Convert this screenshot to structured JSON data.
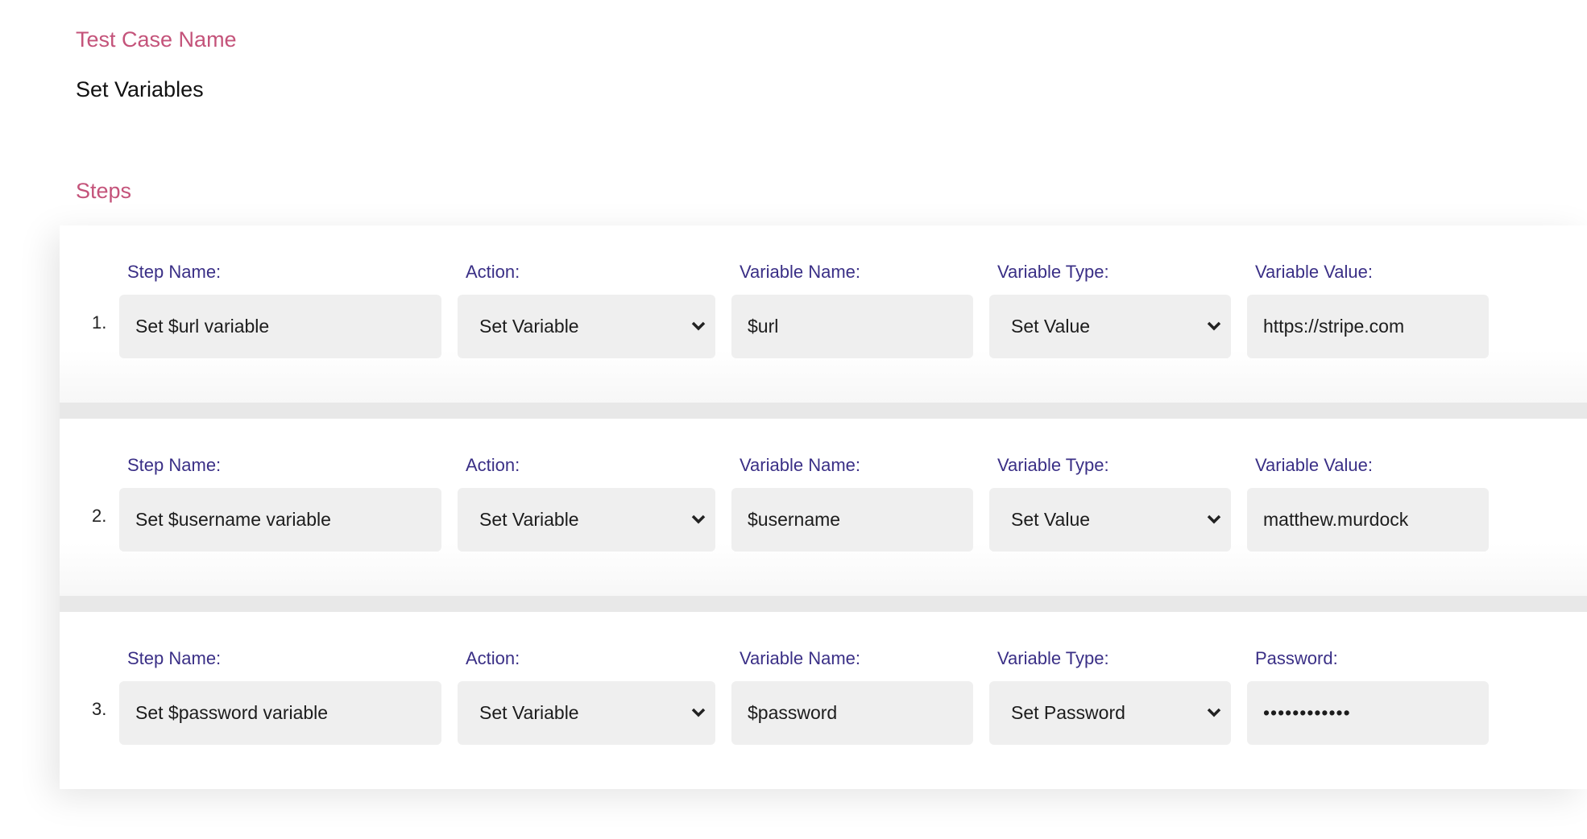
{
  "test_case": {
    "label": "Test Case Name",
    "value": "Set Variables"
  },
  "steps_label": "Steps",
  "steps": [
    {
      "number": "1.",
      "step_name_label": "Step Name:",
      "step_name": "Set $url variable",
      "action_label": "Action:",
      "action": "Set Variable",
      "variable_name_label": "Variable Name:",
      "variable_name": "$url",
      "variable_type_label": "Variable Type:",
      "variable_type": "Set Value",
      "value_label": "Variable Value:",
      "value": "https://stripe.com"
    },
    {
      "number": "2.",
      "step_name_label": "Step Name:",
      "step_name": "Set $username variable",
      "action_label": "Action:",
      "action": "Set Variable",
      "variable_name_label": "Variable Name:",
      "variable_name": "$username",
      "variable_type_label": "Variable Type:",
      "variable_type": "Set Value",
      "value_label": "Variable Value:",
      "value": "matthew.murdock"
    },
    {
      "number": "3.",
      "step_name_label": "Step Name:",
      "step_name": "Set $password variable",
      "action_label": "Action:",
      "action": "Set Variable",
      "variable_name_label": "Variable Name:",
      "variable_name": "$password",
      "variable_type_label": "Variable Type:",
      "variable_type": "Set Password",
      "value_label": "Password:",
      "value": "••••••••••••"
    }
  ],
  "icons": {
    "dropdown": "chevron-down-icon"
  },
  "colors": {
    "section_label": "#c4537a",
    "field_label": "#3a2f86",
    "input_bg": "#efefef"
  }
}
